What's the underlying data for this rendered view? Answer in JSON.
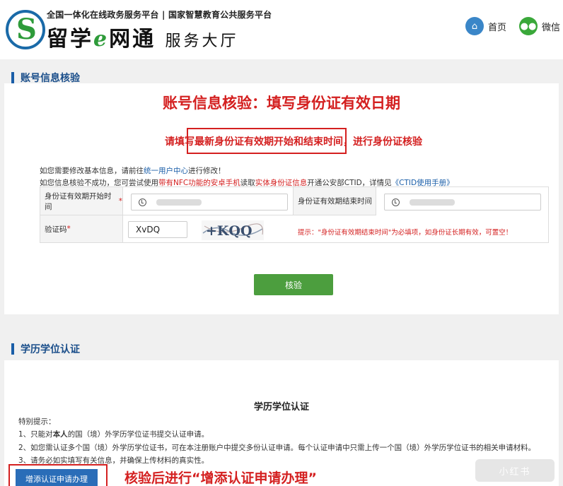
{
  "header": {
    "platform_line": "全国一体化在线政务服务平台 | 国家智慧教育公共服务平台",
    "brand_part1": "留学",
    "brand_e": "e",
    "brand_part2": "网通",
    "brand_sub": "服务大厅",
    "logo_letter": "S",
    "home_label": "首页",
    "wechat_label": "微信"
  },
  "account_section": {
    "title": "账号信息核验",
    "annotation_title": "账号信息核验：填写身份证有效日期",
    "annotation_sub_prefix": "请填写",
    "annotation_sub_highlight": "最新身份证有效期开始和结束时间",
    "annotation_sub_suffix": "，进行身份证核验",
    "info1_prefix": "如您需要修改基本信息，请前往",
    "info1_link": "统一用户中心",
    "info1_suffix": "进行修改！",
    "info2_prefix": "如您信息核验不成功，您可尝试使用",
    "info2_red1": "带有NFC功能的安卓手机",
    "info2_mid": "读取",
    "info2_red2": "实体身份证信息",
    "info2_mid2": "开通公安部CTID，详情见",
    "info2_link": "《CTID使用手册》",
    "start_label": "身份证有效期开始时间",
    "end_label": "身份证有效期结束时间",
    "captcha_label": "验证码",
    "required_mark": "*",
    "captcha_value": "XvDQ",
    "captcha_image_text": "+KQQ",
    "hint": "提示：\"身份证有效期结束时间\"为必填项，如身份证长期有效，可置空！",
    "verify_button": "核验"
  },
  "edu_section": {
    "title": "学历学位认证",
    "heading": "学历学位认证",
    "tips_title": "特别提示：",
    "tip1_prefix": "1、只能对",
    "tip1_bold": "本人",
    "tip1_suffix": "的国（境）外学历学位证书提交认证申请。",
    "tip2": "2、如您需认证多个国（境）外学历学位证书，可在本注册账户中提交多份认证申请。每个认证申请中只需上传一个国（境）外学历学位证书的相关申请材料。",
    "tip3": "3、请务必如实填写有关信息，并确保上传材料的真实性。",
    "add_button": "增添认证申请办理",
    "annotation_after": "核验后进行“增添认证申请办理”"
  },
  "watermark": "小红书",
  "colors": {
    "annotation_red": "#d42020",
    "section_blue": "#1a4e8a",
    "verify_green": "#4c9e3e",
    "add_blue": "#2a6db8"
  }
}
